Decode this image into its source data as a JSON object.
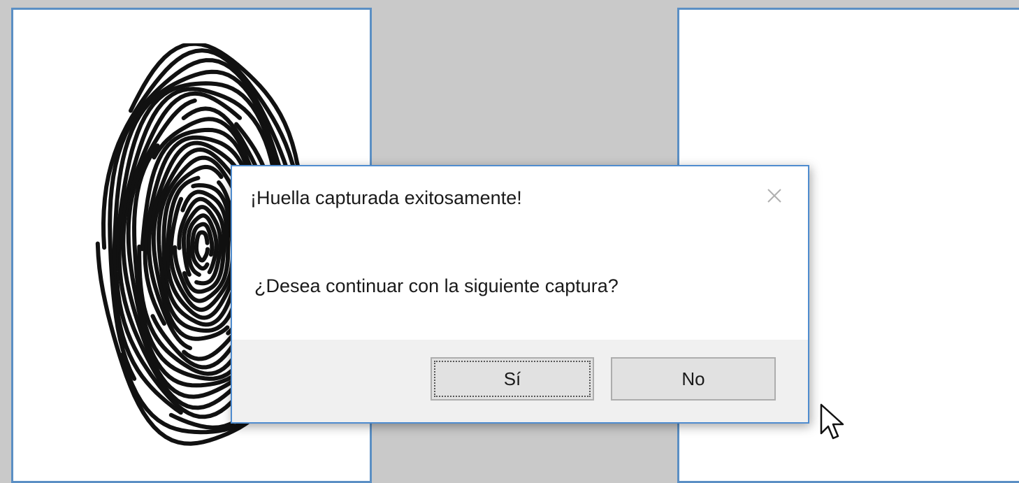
{
  "dialog": {
    "title": "¡Huella capturada exitosamente!",
    "message": "¿Desea continuar con la siguiente captura?",
    "yes_label": "Sí",
    "no_label": "No",
    "close_icon": "close-icon"
  },
  "left_panel": {
    "image": "fingerprint-image"
  },
  "right_panel": {
    "image": "empty"
  },
  "cursor": "arrow-cursor-icon",
  "colors": {
    "background": "#c9c9c9",
    "panel_border": "#5b8fc4",
    "dialog_border": "#4f8ccf",
    "footer": "#f0f0f0",
    "button": "#e1e1e1"
  }
}
